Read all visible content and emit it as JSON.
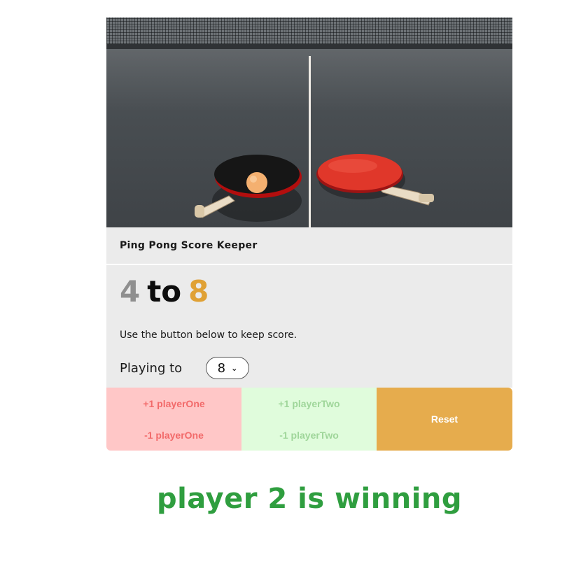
{
  "app": {
    "title": "Ping Pong Score Keeper"
  },
  "hero": {
    "image": "ping-pong-paddles-photo"
  },
  "score": {
    "player_one": "4",
    "separator": "to",
    "player_two": "8"
  },
  "hint": "Use the button below to keep score.",
  "playing_to": {
    "label": "Playing to",
    "selected": "8"
  },
  "buttons": {
    "p1_plus": "+1 playerOne",
    "p1_minus": "-1 playerOne",
    "p2_plus": "+1 playerTwo",
    "p2_minus": "-1 playerTwo",
    "reset": "Reset"
  },
  "status": "player 2 is winning",
  "colors": {
    "player_one_score": "#8f8f8f",
    "player_two_score": "#e0a135",
    "status": "#2f9e3f",
    "reset": "#e6ac4d"
  }
}
